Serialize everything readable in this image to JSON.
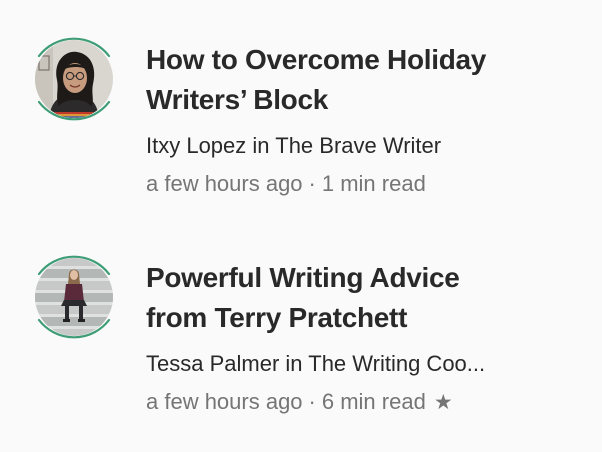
{
  "accent_color": "#3e9d76",
  "stories": [
    {
      "title": "How to Overcome Holiday\nWriters’ Block",
      "author": "Itxy Lopez",
      "in_word": "in",
      "publication": "The Brave Writer",
      "time": "a few hours ago",
      "separator": "·",
      "read_time": "1 min read",
      "avatar_icon": "author-photo-woman-glasses"
    },
    {
      "title": "Powerful Writing Advice\nfrom Terry Pratchett",
      "author": "Tessa Palmer",
      "in_word": "in",
      "publication": "The Writing Coo...",
      "time": "a few hours ago",
      "separator": "·",
      "read_time": "6 min read",
      "star": "★",
      "avatar_icon": "author-photo-woman-sitting-stairs"
    }
  ]
}
